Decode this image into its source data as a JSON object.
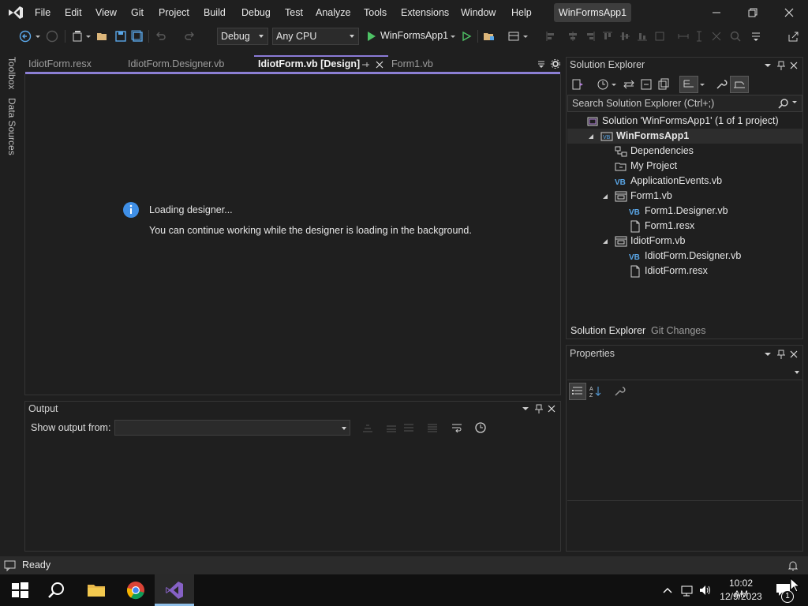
{
  "app": {
    "title_badge": "WinFormsApp1"
  },
  "menu": [
    "File",
    "Edit",
    "View",
    "Git",
    "Project",
    "Build",
    "Debug",
    "Test",
    "Analyze",
    "Tools",
    "Extensions",
    "Window",
    "Help"
  ],
  "toolbar": {
    "configuration": "Debug",
    "platform": "Any CPU",
    "run_target": "WinFormsApp1"
  },
  "left_strip": {
    "toolbox": "Toolbox",
    "data_sources": "Data Sources"
  },
  "tabs": [
    {
      "label": "IdiotForm.resx",
      "active": false
    },
    {
      "label": "IdiotForm.Designer.vb",
      "active": false
    },
    {
      "label": "IdiotForm.vb [Design]",
      "active": true
    },
    {
      "label": "Form1.vb",
      "active": false
    }
  ],
  "designer": {
    "loading_title": "Loading designer...",
    "loading_subtitle": "You can continue working while the designer is loading in the background."
  },
  "output": {
    "title": "Output",
    "show_output_from": "Show output from:",
    "source_value": ""
  },
  "solution_explorer": {
    "title": "Solution Explorer",
    "search_placeholder": "Search Solution Explorer (Ctrl+;)",
    "tree": [
      {
        "label": "Solution 'WinFormsApp1' (1 of 1 project)",
        "icon": "solution-icon",
        "depth": 0,
        "expander": ""
      },
      {
        "label": "WinFormsApp1",
        "icon": "vb-project-icon",
        "depth": 1,
        "expander": "expanded",
        "bold": true,
        "selected": true
      },
      {
        "label": "Dependencies",
        "icon": "dependencies-icon",
        "depth": 2,
        "expander": ""
      },
      {
        "label": "My Project",
        "icon": "my-project-icon",
        "depth": 2,
        "expander": ""
      },
      {
        "label": "ApplicationEvents.vb",
        "icon": "vb-file-icon",
        "depth": 2,
        "expander": ""
      },
      {
        "label": "Form1.vb",
        "icon": "form-icon",
        "depth": 2,
        "expander": "expanded"
      },
      {
        "label": "Form1.Designer.vb",
        "icon": "vb-file-icon",
        "depth": 3,
        "expander": ""
      },
      {
        "label": "Form1.resx",
        "icon": "resx-icon",
        "depth": 3,
        "expander": ""
      },
      {
        "label": "IdiotForm.vb",
        "icon": "form-icon",
        "depth": 2,
        "expander": "expanded"
      },
      {
        "label": "IdiotForm.Designer.vb",
        "icon": "vb-file-icon",
        "depth": 3,
        "expander": ""
      },
      {
        "label": "IdiotForm.resx",
        "icon": "resx-icon",
        "depth": 3,
        "expander": ""
      }
    ],
    "bottom_tabs": [
      "Solution Explorer",
      "Git Changes"
    ]
  },
  "properties": {
    "title": "Properties",
    "object_value": ""
  },
  "status": {
    "text": "Ready"
  },
  "taskbar": {
    "time": "10:02 AM",
    "date": "12/9/2023",
    "notification_count": "1",
    "apps": [
      "windows-start-icon",
      "search-icon",
      "file-explorer-icon",
      "chrome-icon",
      "visual-studio-icon"
    ]
  },
  "colors": {
    "accent": "#8c7fd4",
    "info_blue": "#3f8fe6",
    "vb_blue": "#5aa7e8",
    "run_green": "#4ec265"
  }
}
